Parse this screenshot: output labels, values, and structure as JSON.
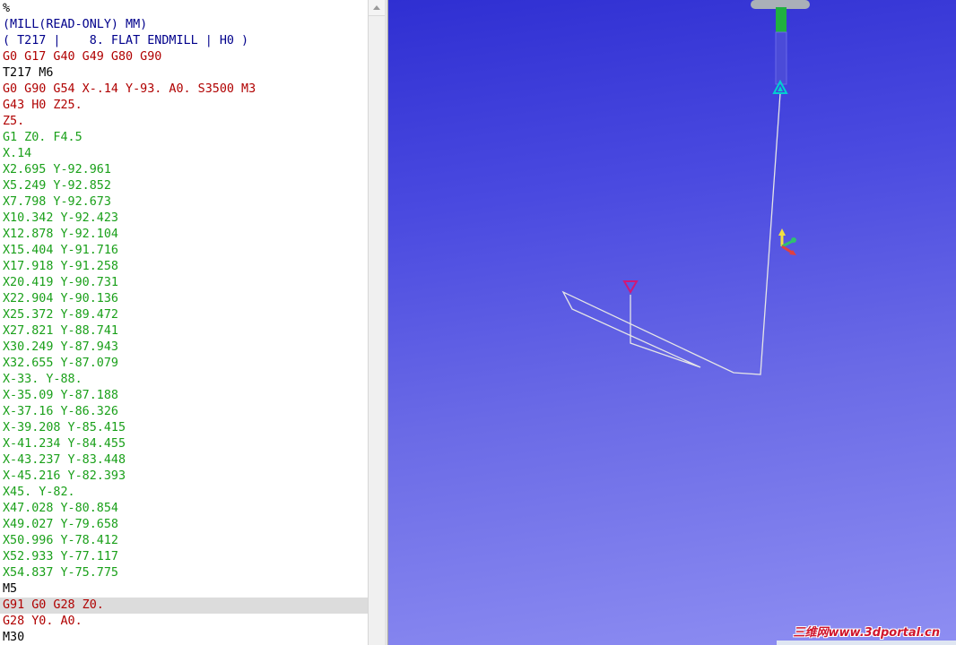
{
  "editor": {
    "lines": [
      {
        "text": "%",
        "color": "#000000"
      },
      {
        "text": "(MILL(READ-ONLY) MM)",
        "color": "#00008b"
      },
      {
        "text": "( T217 |    8. FLAT ENDMILL | H0 )",
        "color": "#00008b"
      },
      {
        "text": "G0 G17 G40 G49 G80 G90",
        "color": "#b00000"
      },
      {
        "text": "T217 M6",
        "color": "#000000"
      },
      {
        "text": "G0 G90 G54 X-.14 Y-93. A0. S3500 M3",
        "color": "#b00000"
      },
      {
        "text": "G43 H0 Z25.",
        "color": "#b00000"
      },
      {
        "text": "Z5.",
        "color": "#b00000"
      },
      {
        "text": "G1 Z0. F4.5",
        "color": "#1aa01a"
      },
      {
        "text": "X.14",
        "color": "#1aa01a"
      },
      {
        "text": "X2.695 Y-92.961",
        "color": "#1aa01a"
      },
      {
        "text": "X5.249 Y-92.852",
        "color": "#1aa01a"
      },
      {
        "text": "X7.798 Y-92.673",
        "color": "#1aa01a"
      },
      {
        "text": "X10.342 Y-92.423",
        "color": "#1aa01a"
      },
      {
        "text": "X12.878 Y-92.104",
        "color": "#1aa01a"
      },
      {
        "text": "X15.404 Y-91.716",
        "color": "#1aa01a"
      },
      {
        "text": "X17.918 Y-91.258",
        "color": "#1aa01a"
      },
      {
        "text": "X20.419 Y-90.731",
        "color": "#1aa01a"
      },
      {
        "text": "X22.904 Y-90.136",
        "color": "#1aa01a"
      },
      {
        "text": "X25.372 Y-89.472",
        "color": "#1aa01a"
      },
      {
        "text": "X27.821 Y-88.741",
        "color": "#1aa01a"
      },
      {
        "text": "X30.249 Y-87.943",
        "color": "#1aa01a"
      },
      {
        "text": "X32.655 Y-87.079",
        "color": "#1aa01a"
      },
      {
        "text": "X-33. Y-88.",
        "color": "#1aa01a"
      },
      {
        "text": "X-35.09 Y-87.188",
        "color": "#1aa01a"
      },
      {
        "text": "X-37.16 Y-86.326",
        "color": "#1aa01a"
      },
      {
        "text": "X-39.208 Y-85.415",
        "color": "#1aa01a"
      },
      {
        "text": "X-41.234 Y-84.455",
        "color": "#1aa01a"
      },
      {
        "text": "X-43.237 Y-83.448",
        "color": "#1aa01a"
      },
      {
        "text": "X-45.216 Y-82.393",
        "color": "#1aa01a"
      },
      {
        "text": "X45. Y-82.",
        "color": "#1aa01a"
      },
      {
        "text": "X47.028 Y-80.854",
        "color": "#1aa01a"
      },
      {
        "text": "X49.027 Y-79.658",
        "color": "#1aa01a"
      },
      {
        "text": "X50.996 Y-78.412",
        "color": "#1aa01a"
      },
      {
        "text": "X52.933 Y-77.117",
        "color": "#1aa01a"
      },
      {
        "text": "X54.837 Y-75.775",
        "color": "#1aa01a"
      },
      {
        "text": "M5",
        "color": "#000000"
      },
      {
        "text": "G91 G0 G28 Z0.",
        "color": "#b00000",
        "highlight": true
      },
      {
        "text": "G28 Y0. A0.",
        "color": "#b00000"
      },
      {
        "text": "M30",
        "color": "#000000"
      }
    ]
  },
  "viewport": {
    "icons": [
      "tool-holder-icon",
      "tool-start-marker-icon",
      "axis-triad-icon",
      "program-origin-marker-icon"
    ],
    "colors": {
      "toolpath": "#e0e0e0",
      "marker_start": "#00c8c8",
      "marker_origin": "#d01878",
      "tool_shank": "#20b040"
    }
  },
  "watermark": "三维网www.3dportal.cn"
}
